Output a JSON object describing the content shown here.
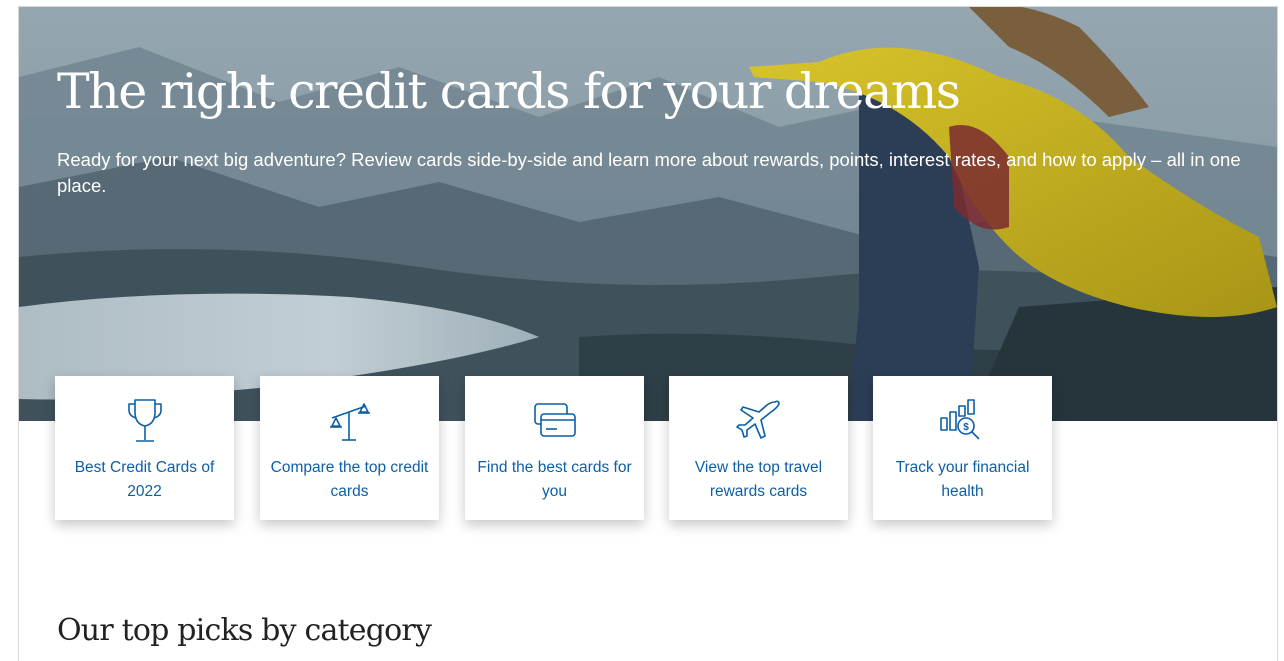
{
  "hero": {
    "title": "The right credit cards for your dreams",
    "subtitle": "Ready for your next big adventure? Review cards side-by-side and learn more about rewards, points, interest rates, and how to apply – all in one place.",
    "image_description_icon": "mountain-lake-woman-yellow-jacket"
  },
  "cards": [
    {
      "label": "Best Credit Cards of 2022",
      "icon": "trophy-icon"
    },
    {
      "label": "Compare the top credit cards",
      "icon": "scale-icon"
    },
    {
      "label": "Find the best cards for you",
      "icon": "credit-cards-icon"
    },
    {
      "label": "View the top travel rewards cards",
      "icon": "airplane-icon"
    },
    {
      "label": "Track your financial health",
      "icon": "chart-magnifier-icon"
    }
  ],
  "section": {
    "title": "Our top picks by category"
  },
  "colors": {
    "accent": "#0d5fa6",
    "jacket": "#c9b21c",
    "title_text": "#222222"
  }
}
